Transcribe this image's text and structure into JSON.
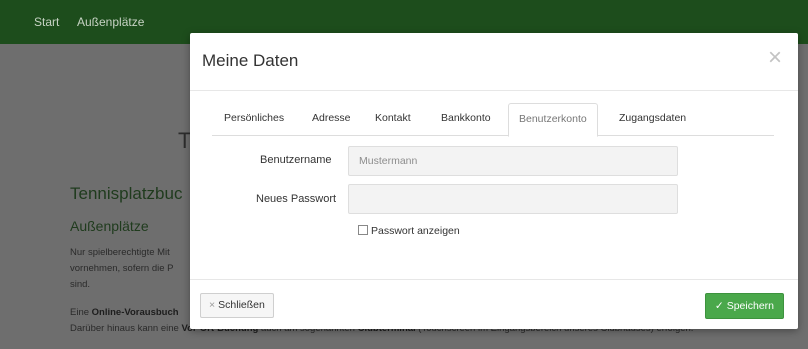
{
  "background": {
    "nav": {
      "start": "Start",
      "outdoor": "Außenplätze"
    },
    "big_letter": "T",
    "heading": "Tennisplatzbuc",
    "subheading": "Außenplätze",
    "para1": [
      "Nur spielberechtigte Mit",
      "vornehmen, sofern die P",
      "sind."
    ],
    "para2": {
      "line1_prefix": "Eine ",
      "line1_bold": "Online-Vorausbuch",
      "line2_prefix": "Darüber hinaus kann eine ",
      "line2_bold1": "Vor-Ort-Buchung",
      "line2_mid": " auch am sogenannten ",
      "line2_bold2": "Clubterminal",
      "line2_suffix": " (Touchscreen im Eingangsbereich unseres Clubhauses) erfolgen."
    }
  },
  "modal": {
    "title": "Meine Daten",
    "close_glyph": "×",
    "tabs": [
      "Persönliches",
      "Adresse",
      "Kontakt",
      "Bankkonto",
      "Benutzerkonto",
      "Zugangsdaten"
    ],
    "active_tab": "Benutzerkonto",
    "form": {
      "username_label": "Benutzername",
      "username_value": "Mustermann",
      "password_label": "Neues Passwort",
      "password_value": "",
      "show_password_label": "Passwort anzeigen",
      "show_password_checked": false
    },
    "footer": {
      "close_label": "Schließen",
      "save_label": "Speichern"
    }
  },
  "colors": {
    "nav_bg": "#1d4d1c",
    "accent_green": "#4aa84b",
    "overlay": "#6e6e6e"
  }
}
